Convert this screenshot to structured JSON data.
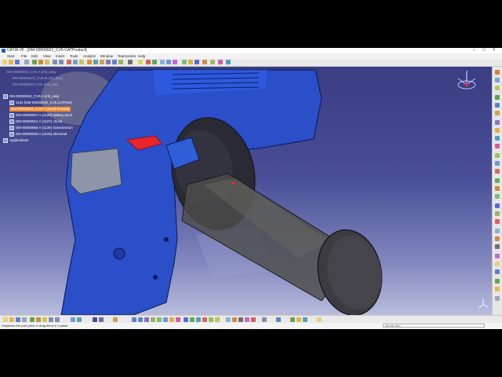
{
  "window": {
    "title": "CATIA V5 - [DM-00000022_CV5-CATProduct]",
    "controls": [
      "–",
      "□",
      "×"
    ]
  },
  "menu": [
    "Start",
    "File",
    "Edit",
    "View",
    "Insert",
    "Tools",
    "Analyze",
    "Window",
    "Teamcenter",
    "Help"
  ],
  "tree": {
    "faded_items": [
      "DM-00000022_CV5 A drill_assy",
      "DM-00000022_CV5 B drill_assy",
      "DM-00000022 CV5 drill_assy"
    ],
    "items": [
      {
        "label": "DM-00000022_CV5 A drill_assy",
        "highlight": false
      },
      {
        "label": "1134 (DM-00000020_CV5.CATPart)",
        "highlight": false
      },
      {
        "label": "DM-00000022_CV5 A (1134) housing",
        "highlight": true
      },
      {
        "label": "DM-00000007 A (1126) battery pack",
        "highlight": false
      },
      {
        "label": "DM-00000012 A (1127) chuck",
        "highlight": false
      },
      {
        "label": "DM-00000065 A (1130) transmission",
        "highlight": false
      },
      {
        "label": "DM-00000033 A (1129) electrical",
        "highlight": false
      },
      {
        "label": "Applications",
        "highlight": false
      }
    ]
  },
  "status": {
    "message": "Displaces the part (click or drag item) in a plane",
    "command_placeholder": "Normal View"
  },
  "colors": {
    "viewport_top": "#3a3d82",
    "part_blue": "#2a4fc9",
    "highlight": "#f08a2a",
    "trigger_red": "#e8262c"
  },
  "icons": [
    "compass-icon",
    "axis-triad-icon",
    "new-icon",
    "open-icon",
    "save-icon",
    "rotate-icon",
    "zoom-in-icon",
    "zoom-out-icon",
    "pan-icon",
    "fit-all-icon"
  ]
}
